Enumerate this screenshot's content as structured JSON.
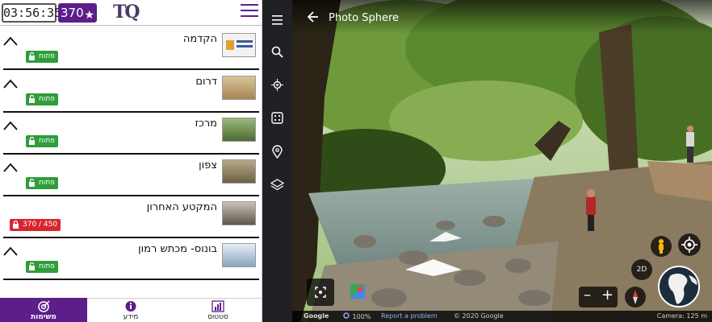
{
  "header": {
    "timer": "03:56:35",
    "points": "370",
    "logo": "TQ"
  },
  "sections": [
    {
      "title": "הקדמה",
      "badge": "פתוח",
      "state": "open",
      "thumb_color": "#e8e8e8"
    },
    {
      "title": "דרום",
      "badge": "פתוח",
      "state": "open",
      "thumb_color": "#c7a36b"
    },
    {
      "title": "מרכז",
      "badge": "פתוח",
      "state": "open",
      "thumb_color": "#6f8c4a"
    },
    {
      "title": "צפון",
      "badge": "פתוח",
      "state": "open",
      "thumb_color": "#8f8060"
    },
    {
      "title": "המקטע האחרון",
      "badge": "370 / 450",
      "state": "locked",
      "thumb_color": "#7a7368"
    },
    {
      "title": "בונוס- מכתש רמון",
      "badge": "פתוח",
      "state": "open",
      "thumb_color": "#b9c6d6"
    }
  ],
  "bottom_nav": {
    "tasks": "משימות",
    "info": "מידע",
    "status": "סטטוס"
  },
  "streetview": {
    "title": "Photo Sphere",
    "google": "Google",
    "zoom_level": "100%",
    "report": "Report a problem",
    "copyright": "© 2020 Google",
    "camera": "Camera: 125 m",
    "mode_2d": "2D"
  },
  "colors": {
    "brand_purple": "#5c1f8a",
    "open_green": "#2e9d3a",
    "locked_red": "#d8262d"
  }
}
